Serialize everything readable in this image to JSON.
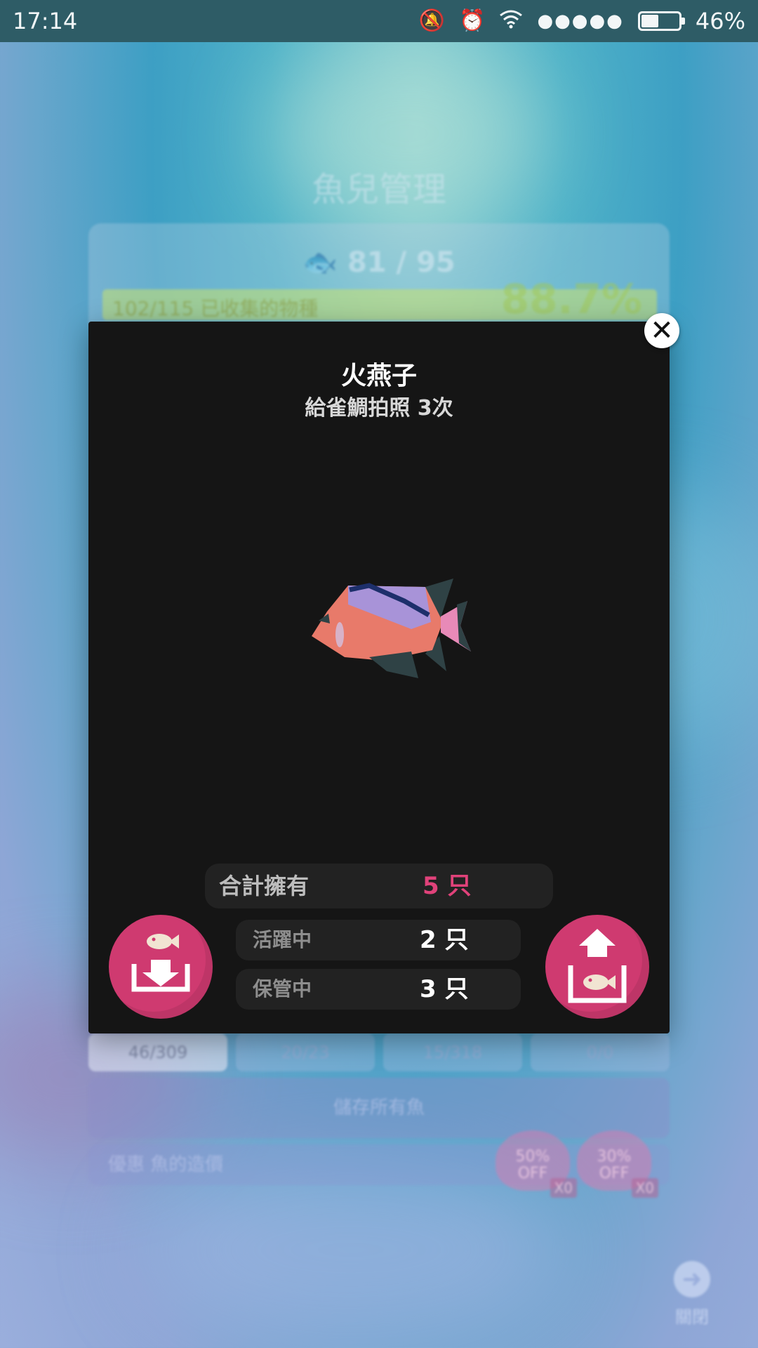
{
  "status_bar": {
    "time": "17:14",
    "battery": "46%",
    "battery_level": 0.46,
    "icons": [
      "mute-icon",
      "alarm-icon",
      "wifi-icon",
      "signal-icon",
      "battery-icon"
    ],
    "signal_dots": "●●●●●"
  },
  "background_page": {
    "title": "魚兒管理",
    "fish_count": "81 / 95",
    "progress_text": "102/115 已收集的物種",
    "progress_percent": "88.7%",
    "progress_value": 0.887,
    "tabs": [
      {
        "label": "46/309"
      },
      {
        "label": "20/23"
      },
      {
        "label": "15/318"
      },
      {
        "label": "0/0"
      }
    ],
    "save_all_label": "儲存所有魚",
    "discount_label": "優惠 魚的造價",
    "discounts": [
      {
        "pct": "50%",
        "off": "OFF",
        "mult": "X0"
      },
      {
        "pct": "30%",
        "off": "OFF",
        "mult": "X0"
      }
    ],
    "close_label": "關閉"
  },
  "modal": {
    "fish_name": "火燕子",
    "subtitle": "給雀鯛拍照 3次",
    "total_label": "合計擁有",
    "total_value": "5 只",
    "active_label": "活躍中",
    "active_value": "2 只",
    "stored_label": "保管中",
    "stored_value": "3 只",
    "close_symbol": "✕"
  },
  "colors": {
    "accent_pink": "#cf3a70",
    "total_value": "#e0427a",
    "modal_bg": "#151515"
  }
}
